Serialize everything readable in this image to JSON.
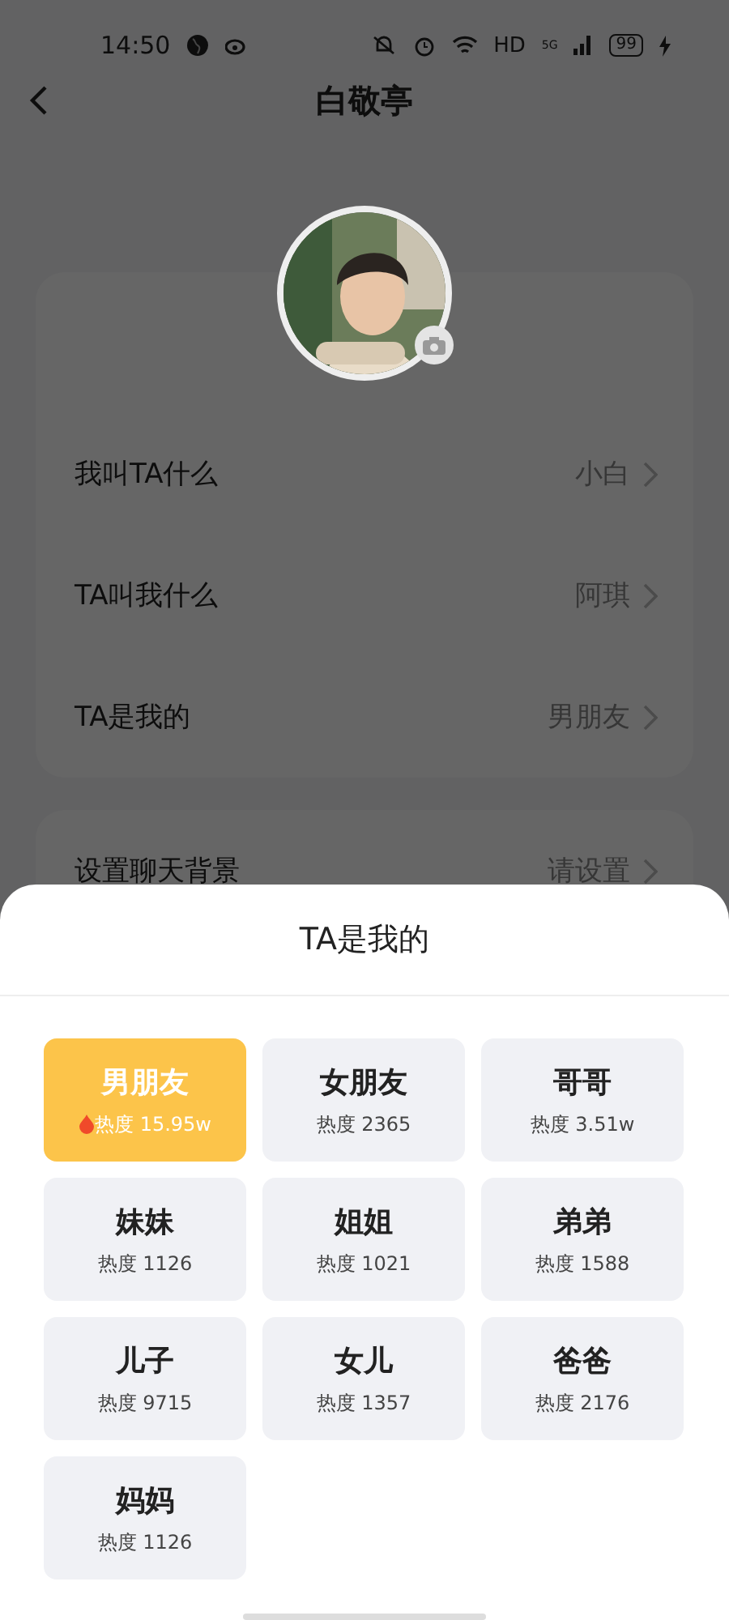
{
  "status_bar": {
    "time": "14:50",
    "network": "HD",
    "signal_type": "5G",
    "battery": "99"
  },
  "header": {
    "title": "白敬亭"
  },
  "profile_rows": [
    {
      "label": "我叫TA什么",
      "value": "小白"
    },
    {
      "label": "TA叫我什么",
      "value": "阿琪"
    },
    {
      "label": "TA是我的",
      "value": "男朋友"
    }
  ],
  "other_rows": [
    {
      "label": "设置聊天背景",
      "value": "请设置"
    }
  ],
  "sheet": {
    "title": "TA是我的",
    "options": [
      {
        "name": "男朋友",
        "heat": "热度 15.95w",
        "selected": true
      },
      {
        "name": "女朋友",
        "heat": "热度 2365",
        "selected": false
      },
      {
        "name": "哥哥",
        "heat": "热度 3.51w",
        "selected": false
      },
      {
        "name": "妹妹",
        "heat": "热度 1126",
        "selected": false
      },
      {
        "name": "姐姐",
        "heat": "热度 1021",
        "selected": false
      },
      {
        "name": "弟弟",
        "heat": "热度 1588",
        "selected": false
      },
      {
        "name": "儿子",
        "heat": "热度 9715",
        "selected": false
      },
      {
        "name": "女儿",
        "heat": "热度 1357",
        "selected": false
      },
      {
        "name": "爸爸",
        "heat": "热度 2176",
        "selected": false
      },
      {
        "name": "妈妈",
        "heat": "热度 1126",
        "selected": false
      }
    ]
  }
}
